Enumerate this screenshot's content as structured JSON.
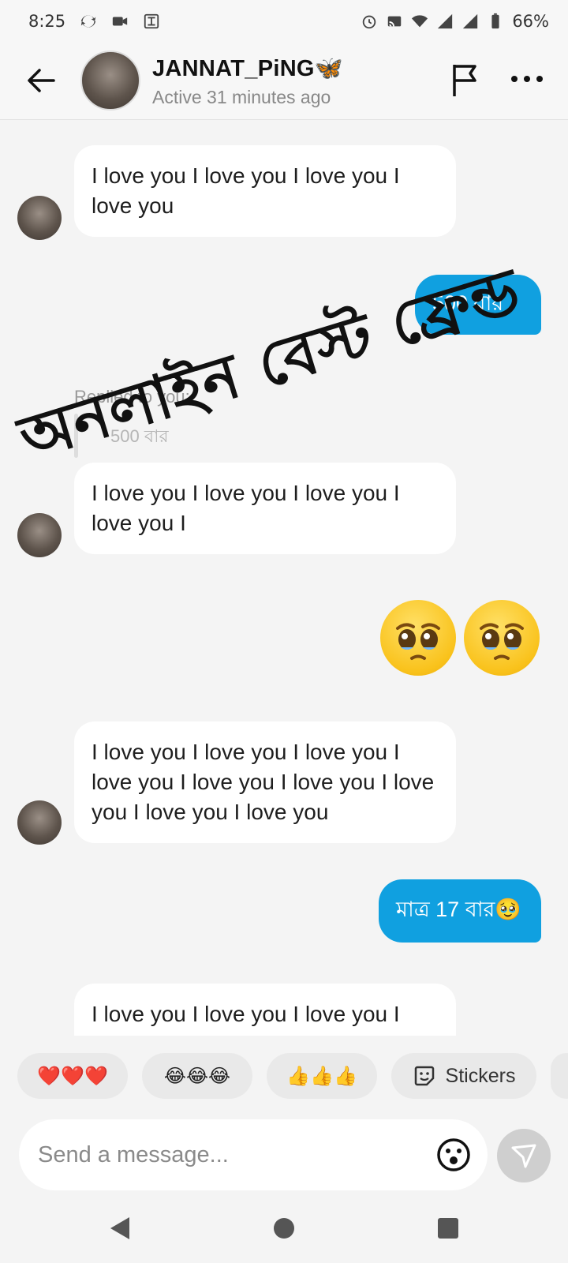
{
  "status_bar": {
    "time": "8:25",
    "battery": "66%",
    "icons": [
      "sync-icon",
      "video-icon",
      "screenshot-icon",
      "alarm-icon",
      "cast-icon",
      "wifi-icon",
      "signal-icon",
      "signal-icon",
      "battery-icon"
    ]
  },
  "header": {
    "name": "JANNAT_PiNG🦋",
    "status": "Active 31 minutes ago"
  },
  "messages": [
    {
      "direction": "in",
      "text": "I love you I love you I love you I love you"
    },
    {
      "direction": "out",
      "text": "500  বার"
    },
    {
      "direction": "in",
      "replied_label": "Replied to you:",
      "replied_text": "500  বার",
      "text": "I love you I love you I love you I love you I"
    },
    {
      "direction": "out",
      "emoji": "🥹🥹"
    },
    {
      "direction": "in",
      "text": "I love you I love you I love you I love you I love you I love you I love you I love you I love you"
    },
    {
      "direction": "out",
      "text": "মাত্র 17 বার🥹"
    },
    {
      "direction": "in",
      "text": "I love you I love you I love you I"
    }
  ],
  "overlay": {
    "text": "অনলাইন বেস্ট ফ্রেন্ড"
  },
  "quick_replies": [
    "❤️❤️❤️",
    "😂😂😂",
    "👍👍👍",
    "Stickers"
  ],
  "composer": {
    "placeholder": "Send a message..."
  },
  "colors": {
    "outgoing_bubble": "#10a0e0",
    "incoming_bubble": "#ffffff",
    "background": "#f4f4f4"
  }
}
